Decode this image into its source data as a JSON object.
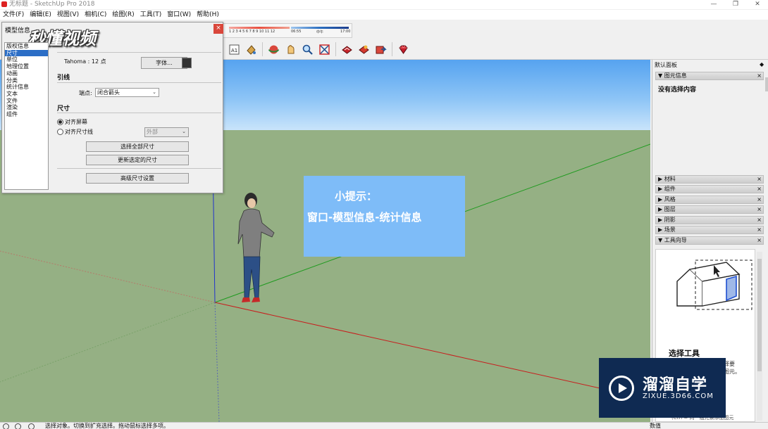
{
  "app": {
    "title": "无标题 - SketchUp Pro 2018",
    "window_buttons": [
      "—",
      "❐",
      "✕"
    ]
  },
  "menu": [
    "文件(F)",
    "编辑(E)",
    "视图(V)",
    "相机(C)",
    "绘图(R)",
    "工具(T)",
    "窗口(W)",
    "帮助(H)"
  ],
  "shadow_toolbar": {
    "months": "1 2 3 4 5 6 7 8 9 10 11 12",
    "time_start": "06:55",
    "time_mid": "中午",
    "time_end": "17:00"
  },
  "toolbar_icons": [
    "3d-text-icon",
    "orbit-icon",
    "pan-icon",
    "zoom-icon",
    "zoom-extents-icon",
    "warehouse-icon",
    "extension-warehouse-icon",
    "send-to-layout-icon",
    "ruby-console-icon"
  ],
  "dialog": {
    "title": "模型信息",
    "close": "×",
    "watermark": "秒懂视频",
    "categories": [
      "版权信息",
      "尺寸",
      "单位",
      "地理位置",
      "动画",
      "分类",
      "统计信息",
      "文本",
      "文件",
      "渲染",
      "组件"
    ],
    "selected_category": 1,
    "font_label": "Tahoma : 12 点",
    "font_button": "字体...",
    "leader_section": "引线",
    "endpoint_label": "端点:",
    "endpoint_value": "闭合箭头",
    "dimension_section": "尺寸",
    "align_screen": "对齐屏幕",
    "align_dimline": "对齐尺寸线",
    "align_dimline_value": "外部",
    "select_all_button": "选择全部尺寸",
    "update_button": "更新选定的尺寸",
    "advanced_button": "高级尺寸设置"
  },
  "tip": {
    "heading": "小提示：",
    "body": "窗口-模型信息-统计信息"
  },
  "tray": {
    "title": "默认面板",
    "entity_info": "图元信息",
    "no_selection": "没有选择内容",
    "panels": [
      "材料",
      "组件",
      "风格",
      "图层",
      "阴影",
      "场景",
      "工具向导"
    ],
    "guide_title": "选择工具",
    "guide_text1": "择要",
    "guide_text2": "图元。",
    "guide_text3": "(Ctrl = 向一组元素添加图元"
  },
  "brand": {
    "name": "溜溜自学",
    "url": "ZIXUE.3D66.COM"
  },
  "status": {
    "message": "选择对象。切换到扩充选择。拖动鼠标选择多项。",
    "measurement_label": "数值"
  }
}
